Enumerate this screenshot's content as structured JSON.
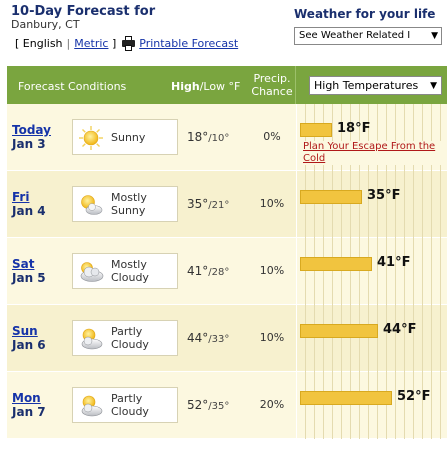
{
  "header": {
    "title": "10-Day Forecast for",
    "location": "Danbury, CT",
    "unit_english": "English",
    "unit_metric": "Metric",
    "printable": "Printable Forecast",
    "life_title": "Weather for your life",
    "life_select": "See Weather Related I"
  },
  "table": {
    "col_conditions": "Forecast Conditions",
    "col_high": "High",
    "col_low_unit": "/Low °F",
    "col_precip_1": "Precip.",
    "col_precip_2": "Chance",
    "chart_select": "High Temperatures"
  },
  "days": [
    {
      "name": "Today",
      "date": "Jan 3",
      "cond1": "Sunny",
      "cond2": "",
      "icon": "sunny-icon",
      "high": "18°",
      "low": "10°",
      "precip": "0%",
      "bar_label": "18°F",
      "high_value": 18,
      "promo": "Plan Your Escape From the Cold"
    },
    {
      "name": "Fri",
      "date": "Jan 4",
      "cond1": "Mostly",
      "cond2": "Sunny",
      "icon": "mostly-sunny-icon",
      "high": "35°",
      "low": "21°",
      "precip": "10%",
      "bar_label": "35°F",
      "high_value": 35
    },
    {
      "name": "Sat",
      "date": "Jan 5",
      "cond1": "Mostly",
      "cond2": "Cloudy",
      "icon": "mostly-cloudy-icon",
      "high": "41°",
      "low": "28°",
      "precip": "10%",
      "bar_label": "41°F",
      "high_value": 41
    },
    {
      "name": "Sun",
      "date": "Jan 6",
      "cond1": "Partly",
      "cond2": "Cloudy",
      "icon": "partly-cloudy-icon",
      "high": "44°",
      "low": "33°",
      "precip": "10%",
      "bar_label": "44°F",
      "high_value": 44
    },
    {
      "name": "Mon",
      "date": "Jan 7",
      "cond1": "Partly",
      "cond2": "Cloudy",
      "icon": "partly-cloudy-icon",
      "high": "52°",
      "low": "35°",
      "precip": "20%",
      "bar_label": "52°F",
      "high_value": 52
    }
  ],
  "colors": {
    "header_green": "#7aa53f",
    "bar_yellow": "#f1c43f",
    "link_blue": "#1533a8",
    "promo_red": "#b01818"
  }
}
